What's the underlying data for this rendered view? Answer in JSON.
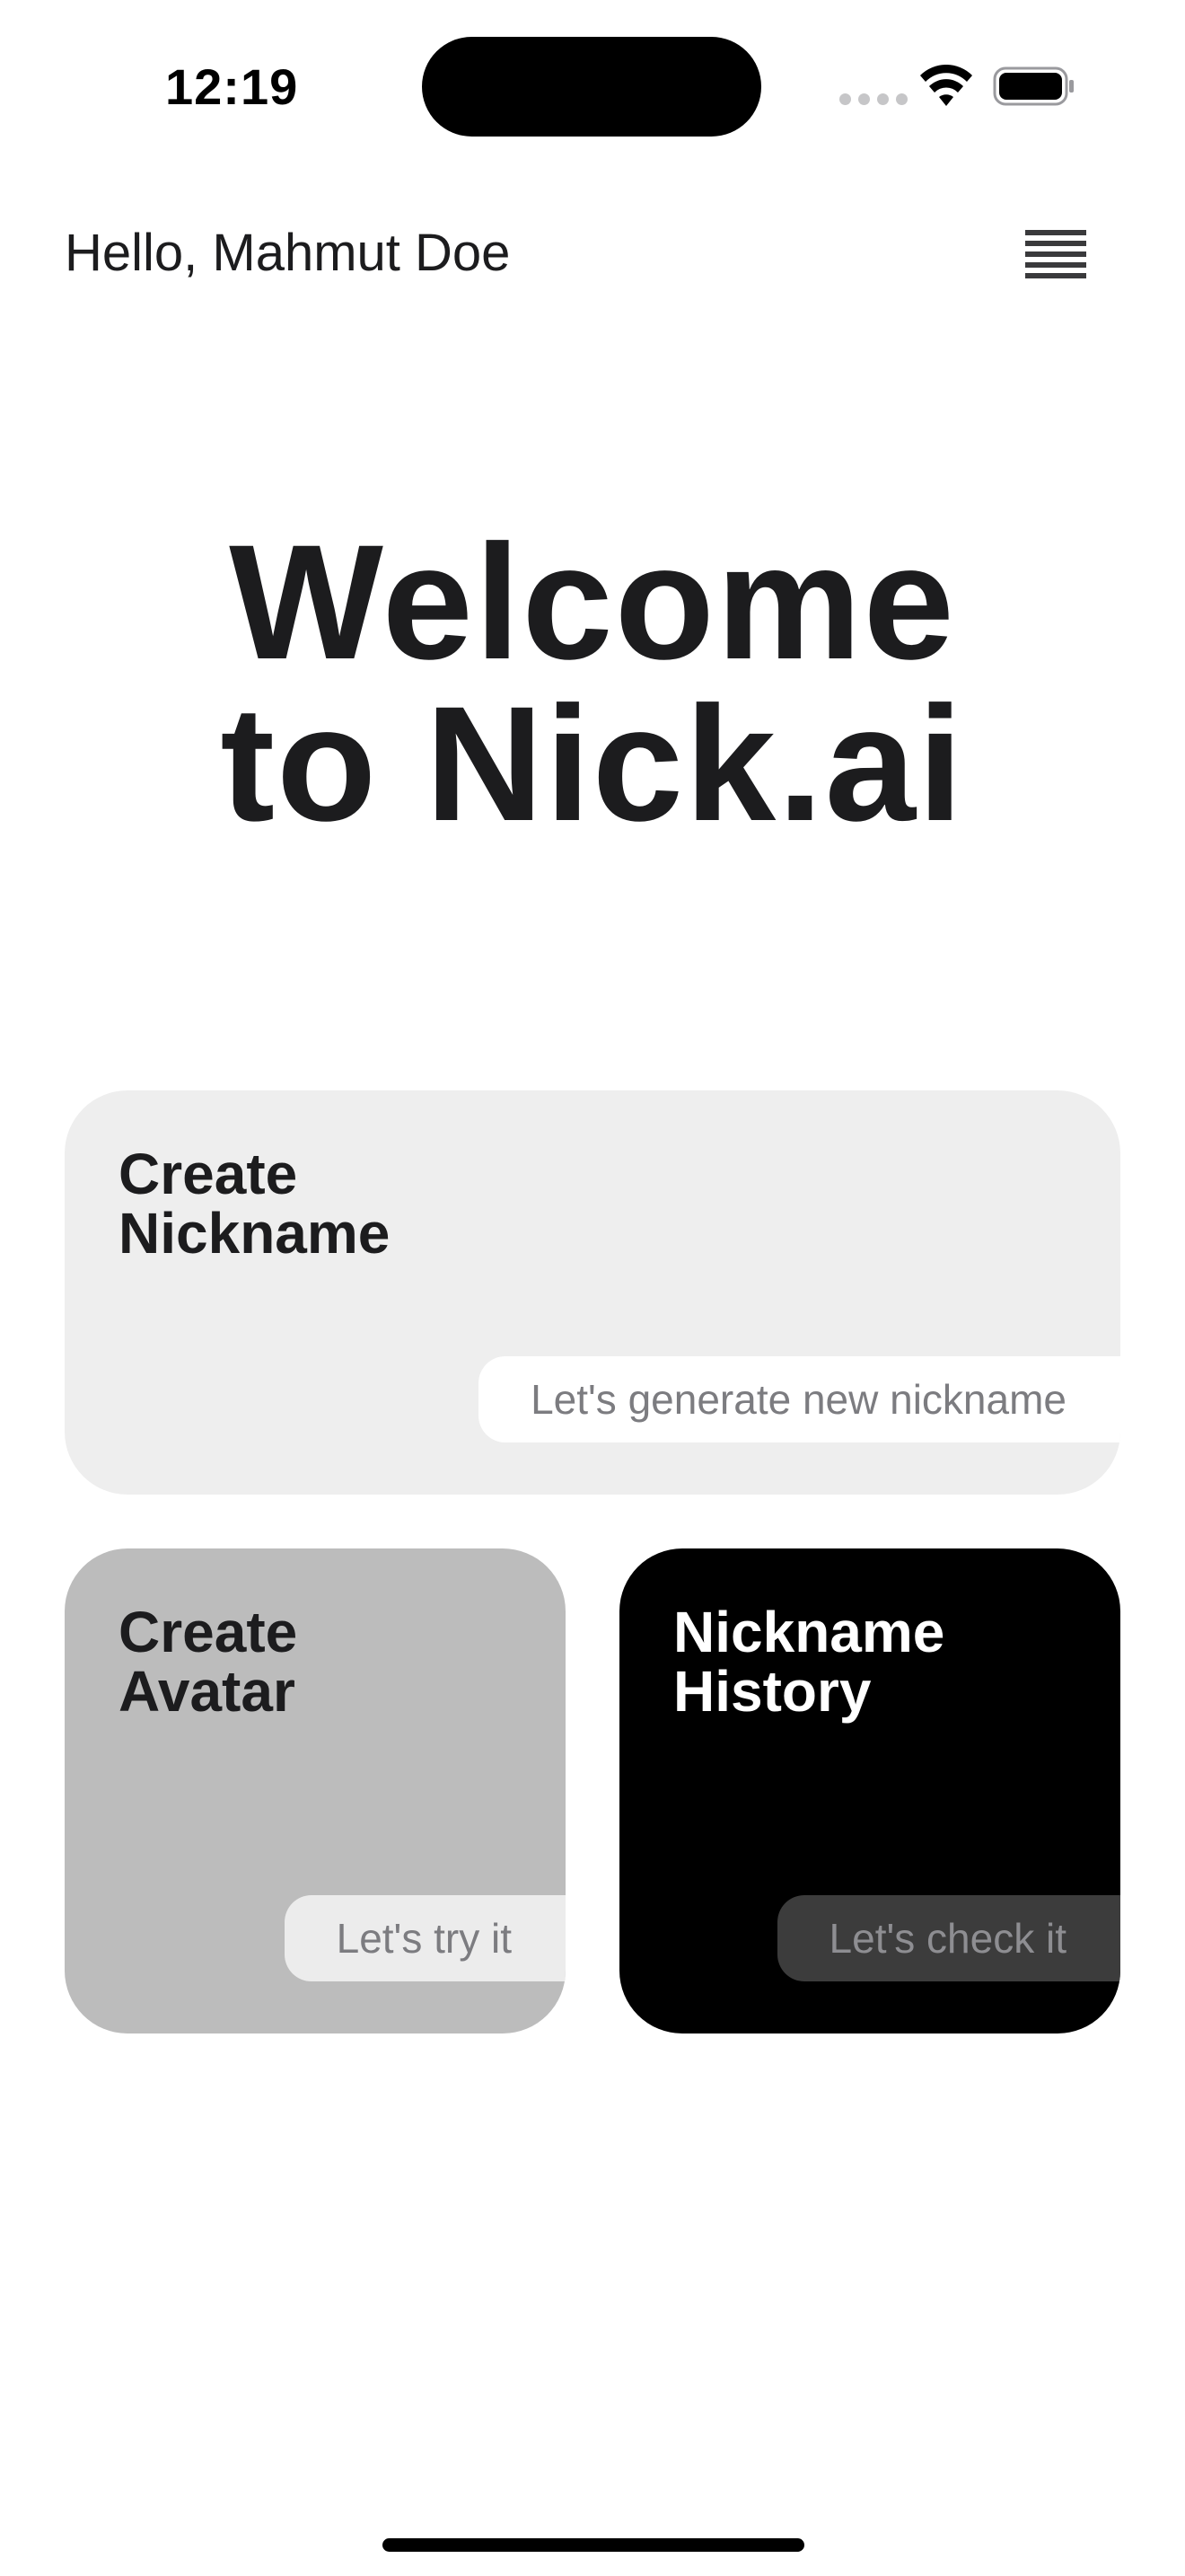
{
  "status_bar": {
    "time": "12:19",
    "icons": [
      "cellular-signal-icon",
      "wifi-icon",
      "battery-icon"
    ]
  },
  "header": {
    "greeting": "Hello, Mahmut Doe",
    "menu_icon": "hamburger-menu-icon"
  },
  "hero": {
    "line1": "Welcome",
    "line2": "to Nick.ai"
  },
  "cards": {
    "create_nickname": {
      "title": "Create\nNickname",
      "action": "Let's generate new nickname",
      "color": "#eeeeee"
    },
    "create_avatar": {
      "title": "Create\nAvatar",
      "action": "Let's try it",
      "color": "#bcbcbc"
    },
    "nickname_history": {
      "title": "Nickname\nHistory",
      "action": "Let's check it",
      "color": "#000000"
    }
  },
  "colors": {
    "text_primary": "#1c1c1e",
    "pill_text": "#7c7c80",
    "background": "#ffffff"
  }
}
